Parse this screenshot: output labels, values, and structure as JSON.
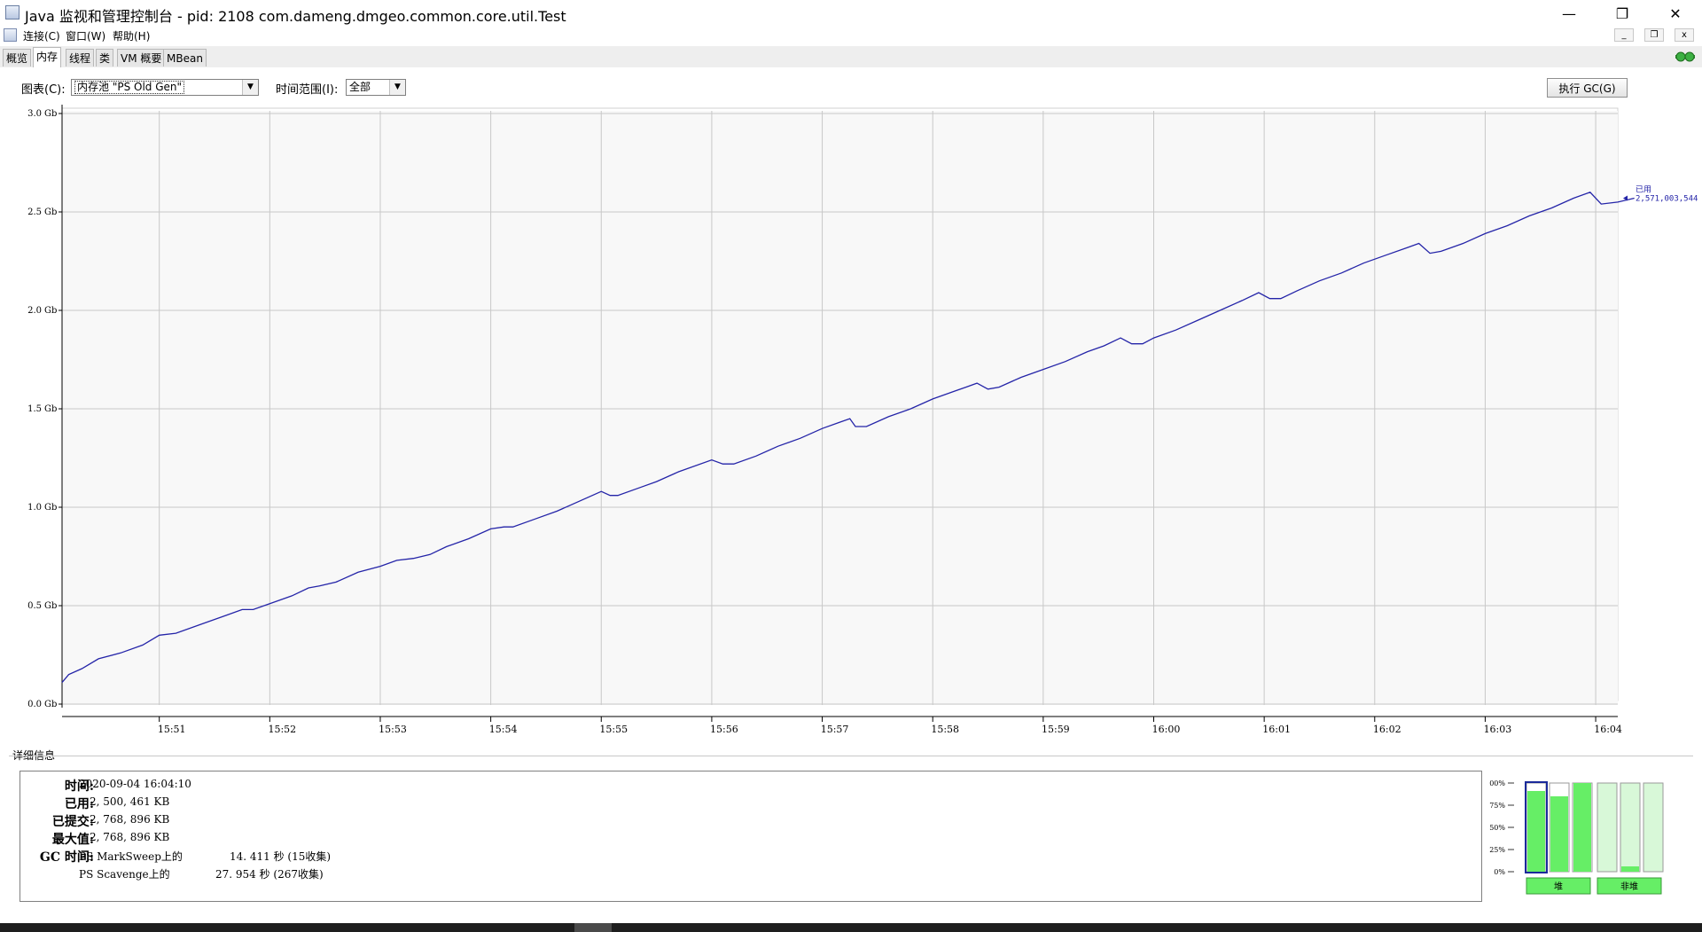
{
  "window": {
    "title": "Java 监视和管理控制台 - pid: 2108 com.dameng.dmgeo.common.core.util.Test",
    "controls": {
      "minimize": "—",
      "restore": "❐",
      "close": "✕"
    }
  },
  "menubar": {
    "items": [
      "连接(C)",
      "窗口(W)",
      "帮助(H)"
    ],
    "mdi": {
      "minimize": "_",
      "restore": "❐",
      "close": "x"
    }
  },
  "tabs": [
    {
      "label": "概览",
      "active": false
    },
    {
      "label": "内存",
      "active": true
    },
    {
      "label": "线程",
      "active": false
    },
    {
      "label": "类",
      "active": false
    },
    {
      "label": "VM 概要",
      "active": false
    },
    {
      "label": "MBean",
      "active": false
    }
  ],
  "toolbar": {
    "chart_label": "图表(C):",
    "chart_value": "内存池 \"PS Old Gen\"",
    "range_label": "时间范围(I):",
    "range_value": "全部",
    "gc_button": "执行 GC(G)"
  },
  "chart_data": {
    "type": "line",
    "y_ticks": [
      "0.0 Gb",
      "0.5 Gb",
      "1.0 Gb",
      "1.5 Gb",
      "2.0 Gb",
      "2.5 Gb",
      "3.0 Gb"
    ],
    "ylim": [
      0,
      3.0
    ],
    "x_ticks": [
      "15:51",
      "15:52",
      "15:53",
      "15:54",
      "15:55",
      "15:56",
      "15:57",
      "15:58",
      "15:59",
      "16:00",
      "16:01",
      "16:02",
      "16:03",
      "16:04"
    ],
    "xlim_minutes": [
      50.12,
      64.2
    ],
    "grid": true,
    "series": [
      {
        "name": "已用",
        "color": "#2424a8",
        "points": [
          [
            50.12,
            0.11
          ],
          [
            50.18,
            0.15
          ],
          [
            50.3,
            0.18
          ],
          [
            50.45,
            0.23
          ],
          [
            50.65,
            0.26
          ],
          [
            50.85,
            0.3
          ],
          [
            51.0,
            0.35
          ],
          [
            51.15,
            0.36
          ],
          [
            51.4,
            0.41
          ],
          [
            51.6,
            0.45
          ],
          [
            51.75,
            0.48
          ],
          [
            51.85,
            0.48
          ],
          [
            52.0,
            0.51
          ],
          [
            52.2,
            0.55
          ],
          [
            52.35,
            0.59
          ],
          [
            52.45,
            0.6
          ],
          [
            52.6,
            0.62
          ],
          [
            52.8,
            0.67
          ],
          [
            53.0,
            0.7
          ],
          [
            53.15,
            0.73
          ],
          [
            53.3,
            0.74
          ],
          [
            53.45,
            0.76
          ],
          [
            53.6,
            0.8
          ],
          [
            53.8,
            0.84
          ],
          [
            54.0,
            0.89
          ],
          [
            54.12,
            0.9
          ],
          [
            54.2,
            0.9
          ],
          [
            54.4,
            0.94
          ],
          [
            54.6,
            0.98
          ],
          [
            54.8,
            1.03
          ],
          [
            55.0,
            1.08
          ],
          [
            55.08,
            1.06
          ],
          [
            55.15,
            1.06
          ],
          [
            55.35,
            1.1
          ],
          [
            55.5,
            1.13
          ],
          [
            55.7,
            1.18
          ],
          [
            56.0,
            1.24
          ],
          [
            56.1,
            1.22
          ],
          [
            56.2,
            1.22
          ],
          [
            56.4,
            1.26
          ],
          [
            56.6,
            1.31
          ],
          [
            56.8,
            1.35
          ],
          [
            57.0,
            1.4
          ],
          [
            57.15,
            1.43
          ],
          [
            57.25,
            1.45
          ],
          [
            57.3,
            1.41
          ],
          [
            57.4,
            1.41
          ],
          [
            57.6,
            1.46
          ],
          [
            57.8,
            1.5
          ],
          [
            58.0,
            1.55
          ],
          [
            58.2,
            1.59
          ],
          [
            58.3,
            1.61
          ],
          [
            58.4,
            1.63
          ],
          [
            58.5,
            1.6
          ],
          [
            58.6,
            1.61
          ],
          [
            58.8,
            1.66
          ],
          [
            59.0,
            1.7
          ],
          [
            59.2,
            1.74
          ],
          [
            59.4,
            1.79
          ],
          [
            59.55,
            1.82
          ],
          [
            59.7,
            1.86
          ],
          [
            59.8,
            1.83
          ],
          [
            59.9,
            1.83
          ],
          [
            60.0,
            1.86
          ],
          [
            60.2,
            1.9
          ],
          [
            60.4,
            1.95
          ],
          [
            60.6,
            2.0
          ],
          [
            60.8,
            2.05
          ],
          [
            60.95,
            2.09
          ],
          [
            61.05,
            2.06
          ],
          [
            61.15,
            2.06
          ],
          [
            61.3,
            2.1
          ],
          [
            61.5,
            2.15
          ],
          [
            61.7,
            2.19
          ],
          [
            61.9,
            2.24
          ],
          [
            62.1,
            2.28
          ],
          [
            62.3,
            2.32
          ],
          [
            62.4,
            2.34
          ],
          [
            62.5,
            2.29
          ],
          [
            62.6,
            2.3
          ],
          [
            62.8,
            2.34
          ],
          [
            63.0,
            2.39
          ],
          [
            63.2,
            2.43
          ],
          [
            63.4,
            2.48
          ],
          [
            63.6,
            2.52
          ],
          [
            63.8,
            2.57
          ],
          [
            63.95,
            2.6
          ],
          [
            64.05,
            2.54
          ],
          [
            64.2,
            2.55
          ],
          [
            64.35,
            2.57
          ]
        ]
      }
    ],
    "current_label": "已用",
    "current_value": "2,571,003,544"
  },
  "details": {
    "section_title": "详细信息",
    "time_label": "时间:",
    "time_value": "2020-09-04 16:04:10",
    "used_label": "已用:",
    "used_value": "2, 500, 461 KB",
    "committed_label": "已提交:",
    "committed_value": "2, 768, 896 KB",
    "max_label": "最大值:",
    "max_value": "2, 768, 896 KB",
    "gc_label": "GC 时间:",
    "gc_rows": [
      {
        "name": "PS MarkSweep上的",
        "value": "14. 411 秒 (15收集)"
      },
      {
        "name": "PS Scavenge上的",
        "value": "27. 954 秒 (267收集)"
      }
    ]
  },
  "gauges": {
    "ticks": [
      "100%",
      "75%",
      "50%",
      "25%",
      "0%"
    ],
    "heap_label": "堆",
    "nonheap_label": "非堆",
    "heap_levels": [
      0.91,
      0.85,
      1.0
    ],
    "nonheap_levels": [
      0.0,
      0.06,
      0.0
    ],
    "fill_color": "#66ee66",
    "light_fill": "#d8f8d8"
  }
}
